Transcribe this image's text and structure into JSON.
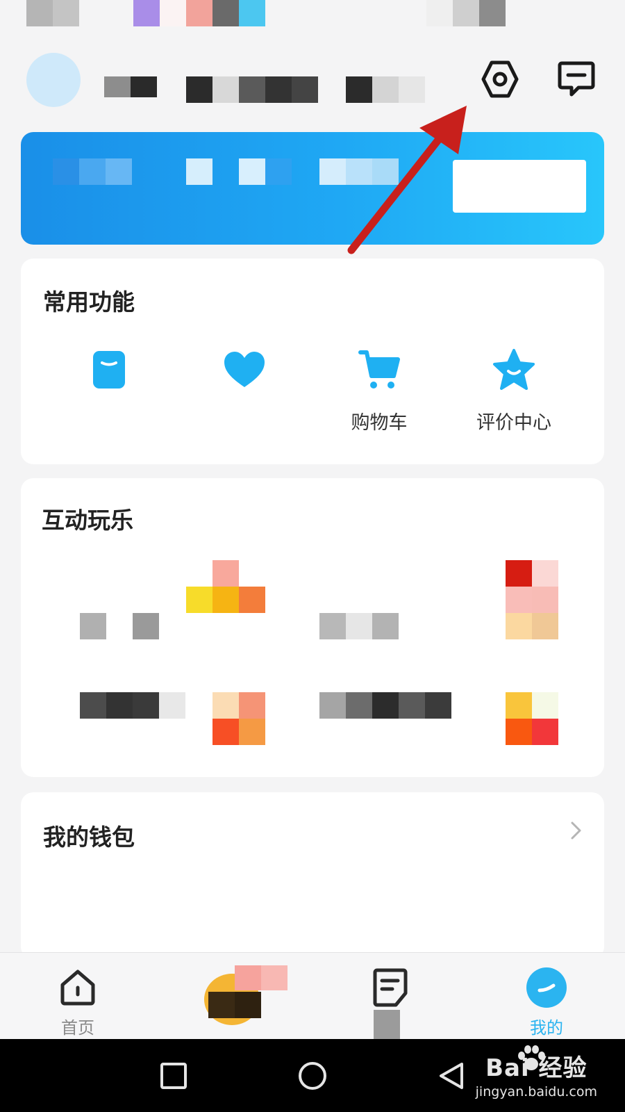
{
  "common_functions": {
    "title": "常用功能",
    "items": [
      {
        "icon": "wallet-icon",
        "label": ""
      },
      {
        "icon": "heart-icon",
        "label": ""
      },
      {
        "icon": "cart-icon",
        "label": "购物车"
      },
      {
        "icon": "star-icon",
        "label": "评价中心"
      }
    ]
  },
  "interactive_fun": {
    "title": "互动玩乐"
  },
  "wallet": {
    "title": "我的钱包"
  },
  "bottom_nav": {
    "items": [
      {
        "icon": "home-icon",
        "label": "首页"
      },
      {
        "icon": "center-promo-icon",
        "label": ""
      },
      {
        "icon": "notes-icon",
        "label": ""
      },
      {
        "icon": "profile-icon",
        "label": "我的"
      }
    ]
  },
  "watermark": {
    "brand": "Bai  经验",
    "url": "jingyan.baidu.com"
  },
  "colors": {
    "accent": "#2bb4f0",
    "banner_start": "#1a8fe8",
    "banner_end": "#28c6fb",
    "annotation_arrow": "#c8201c"
  }
}
